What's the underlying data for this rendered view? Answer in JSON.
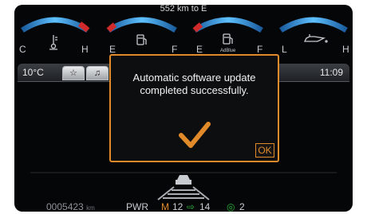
{
  "gauges": [
    {
      "left_label": "C",
      "right_label": "H",
      "icon": "coolant-temp-icon"
    },
    {
      "left_label": "E",
      "right_label": "F",
      "icon": "fuel-pump-icon"
    },
    {
      "left_label": "E",
      "right_label": "F",
      "icon": "adblue-icon",
      "sub_label": "AdBlue"
    },
    {
      "left_label": "L",
      "right_label": "H",
      "icon": "oil-can-icon"
    }
  ],
  "range_text": "552 km to E",
  "status": {
    "outside_temp": "10°C",
    "tabs": [
      "☆",
      "♫"
    ],
    "time": "11:09"
  },
  "dialog": {
    "message": "Automatic software update\ncompleted successfully.",
    "ok_label": "OK",
    "icon": "checkmark-icon"
  },
  "bottom": {
    "odometer": "0005423",
    "odometer_unit": "km",
    "mode": "PWR",
    "gear_mode": "M",
    "gear_current": "12",
    "gear_next": "14",
    "eco_value": "2"
  },
  "colors": {
    "accent": "#e08a2a",
    "gauge_blue": "#2a8fd8",
    "gauge_red": "#d02a2a",
    "eco_green": "#2ab33a"
  }
}
